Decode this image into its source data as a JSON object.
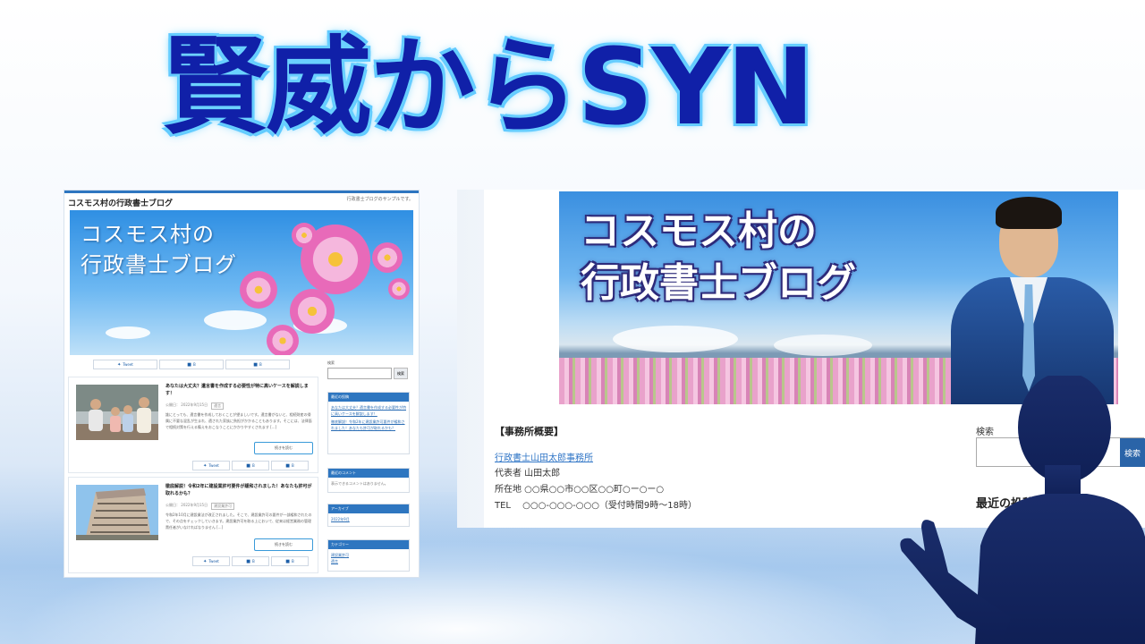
{
  "headline": "賢威からSYN",
  "left_blog": {
    "title": "コスモス村の行政書士ブログ",
    "description": "行政書士ブログのサンプルです。",
    "hero_text_line1": "コスモス村の",
    "hero_text_line2": "行政書士ブログ",
    "share_top": [
      "Tweet",
      "B",
      "B"
    ],
    "posts": [
      {
        "title": "あなたは大丈夫？遺言書を作成する必要性が特に高いケースを解説します！",
        "date": "公開日： 2022年9月15日",
        "tag": "遺言",
        "body": "誰にとっても、遺言書を作成しておくことが望ましいです。遺言書がないと、相続財産の帰属に不要な混乱が生まれ、遺された家族に負担がかかることもあります。そこには、法律面で相続対策を行える備えをおこなうことにかかりやすくされます [...]",
        "more": "続きを読む",
        "share": [
          "Tweet",
          "B",
          "B"
        ]
      },
      {
        "title": "徹底解説！令和2年に建設業許可要件が緩和されました！あなたも許可が取れるかも？",
        "date": "公開日： 2022年9月15日",
        "tag": "建設業許可",
        "body": "令和2年10月に建設業法が改正されました。そこで、建設業許可の要件が一部緩和されたので、その点をチェックしていきます。建設業許可を取る上において、従来は経営業務の管理責任者がいなければなりません [...]",
        "more": "続きを読む",
        "share": [
          "Tweet",
          "B",
          "B"
        ]
      }
    ],
    "sidebar": {
      "search_label": "検索",
      "search_button": "検索",
      "recent_head": "最近の投稿",
      "recent_items": [
        "あなたは大丈夫？遺言書を作成する必要性が特に高いケースを解説します！",
        "徹底解説！令和2年に建設業許可要件が緩和されました！あなたも許可が取れるかも？"
      ],
      "comments_head": "最近のコメント",
      "comments_body": "表示できるコメントはありません。",
      "archive_head": "アーカイブ",
      "archive_items": [
        "2022年9月"
      ],
      "category_head": "カテゴリー",
      "category_items": [
        "建設業許可",
        "遺言"
      ]
    }
  },
  "right_blog": {
    "banner_line1": "コスモス村の",
    "banner_line2": "行政書士ブログ",
    "section_title": "【事務所概要】",
    "office_link": "行政書士山田太郎事務所",
    "rep": "代表者 山田太郎",
    "address": "所在地 ○○県○○市○○区○○町○ー○ー○",
    "tel": "TEL　 ○○○-○○○-○○○（受付時間9時～18時）",
    "search_label": "検索",
    "search_button": "検索",
    "recent_title": "最近の投稿"
  },
  "colors": {
    "headline": "#1020a8",
    "headline_glow": "#5cc6ff",
    "accent": "#2e76c0"
  }
}
